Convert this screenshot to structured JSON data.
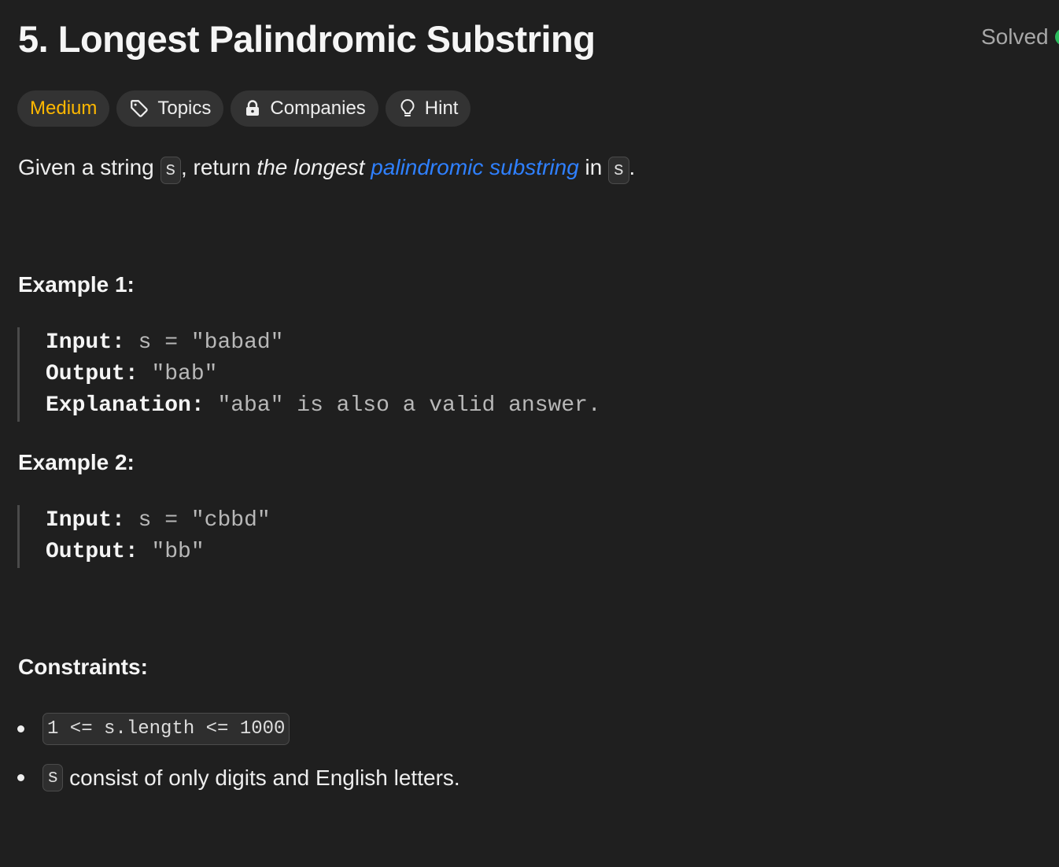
{
  "problem": {
    "title": "5. Longest Palindromic Substring",
    "status": "Solved"
  },
  "chips": {
    "difficulty": "Medium",
    "topics": "Topics",
    "companies": "Companies",
    "hint": "Hint"
  },
  "description": {
    "prefix": "Given a string ",
    "var1": "s",
    "middle": ", return ",
    "emphasis": "the longest",
    "space": " ",
    "link": "palindromic substring",
    "suffix": " in ",
    "var2": "s",
    "end": "."
  },
  "examples": [
    {
      "title": "Example 1:",
      "input_label": "Input:",
      "input_value": "s = \"babad\"",
      "output_label": "Output:",
      "output_value": "\"bab\"",
      "explanation_label": "Explanation:",
      "explanation_value": "\"aba\" is also a valid answer."
    },
    {
      "title": "Example 2:",
      "input_label": "Input:",
      "input_value": "s = \"cbbd\"",
      "output_label": "Output:",
      "output_value": "\"bb\""
    }
  ],
  "constraints": {
    "title": "Constraints:",
    "item1_code": "1 <= s.length <= 1000",
    "item2_code": "s",
    "item2_text": " consist of only digits and English letters."
  },
  "colors": {
    "background": "#1f1f1f",
    "difficulty_medium": "#ffb800",
    "link": "#2f80ff",
    "solved": "#2cbb5d"
  }
}
